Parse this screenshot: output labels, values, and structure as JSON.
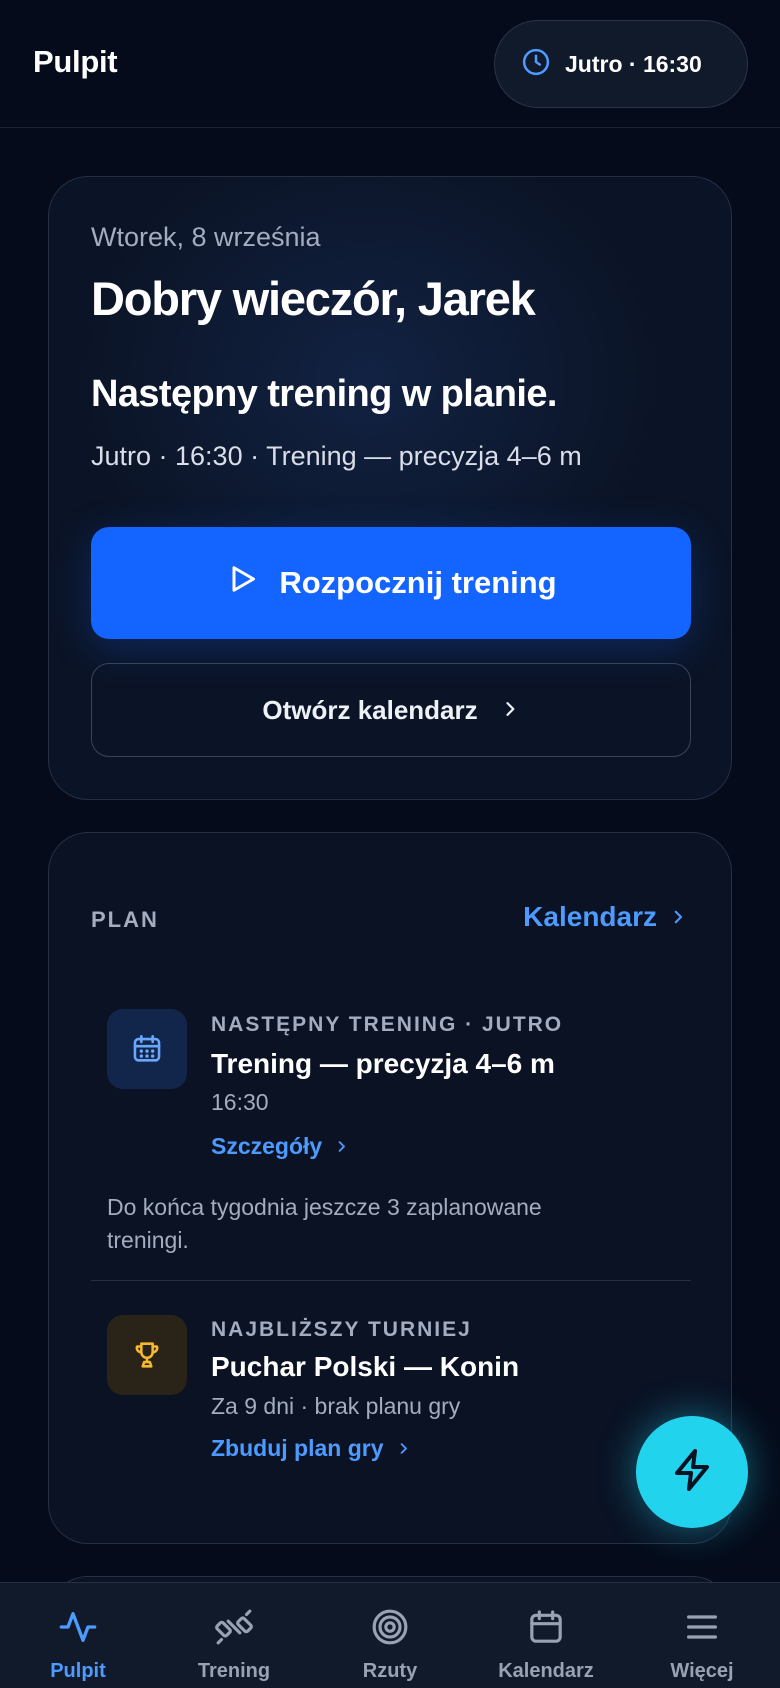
{
  "header": {
    "title": "Pulpit",
    "schedule_pill": {
      "icon": "clock-icon",
      "label": "Jutro · 16:30"
    }
  },
  "hero": {
    "date": "Wtorek, 8 września",
    "greeting": "Dobry wieczór, Jarek",
    "headline": "Następny trening w planie.",
    "meta": "Jutro · 16:30 · Trening — precyzja 4–6 m",
    "primary_button": {
      "icon": "play-icon",
      "label": "Rozpocznij trening"
    },
    "secondary_button": {
      "label": "Otwórz kalendarz",
      "icon": "chevron-right-icon"
    }
  },
  "plan": {
    "section_label": "PLAN",
    "calendar_link": "Kalendarz",
    "next_training": {
      "icon": "calendar-icon",
      "kicker": "NASTĘPNY TRENING · JUTRO",
      "title": "Trening — precyzja 4–6 m",
      "time": "16:30",
      "link": "Szczegóły"
    },
    "week_note": "Do końca tygodnia jeszcze 3 zaplanowane treningi.",
    "tournament": {
      "icon": "trophy-icon",
      "kicker": "NAJBLIŻSZY TURNIEJ",
      "title": "Puchar Polski — Konin",
      "subtitle": "Za 9 dni · brak planu gry",
      "link": "Zbuduj plan gry"
    }
  },
  "fab": {
    "icon": "lightning-icon"
  },
  "tabbar": {
    "tabs": [
      {
        "label": "Pulpit",
        "icon": "activity-icon",
        "active": true
      },
      {
        "label": "Trening",
        "icon": "dumbbell-icon",
        "active": false
      },
      {
        "label": "Rzuty",
        "icon": "target-icon",
        "active": false
      },
      {
        "label": "Kalendarz",
        "icon": "calendar-icon",
        "active": false
      },
      {
        "label": "Więcej",
        "icon": "menu-icon",
        "active": false
      }
    ]
  },
  "colors": {
    "background": "#050b1a",
    "accent_blue": "#1464ff",
    "link_blue": "#4d9bff",
    "fab_cyan": "#22d3ee",
    "trophy_gold": "#f5b82e"
  }
}
